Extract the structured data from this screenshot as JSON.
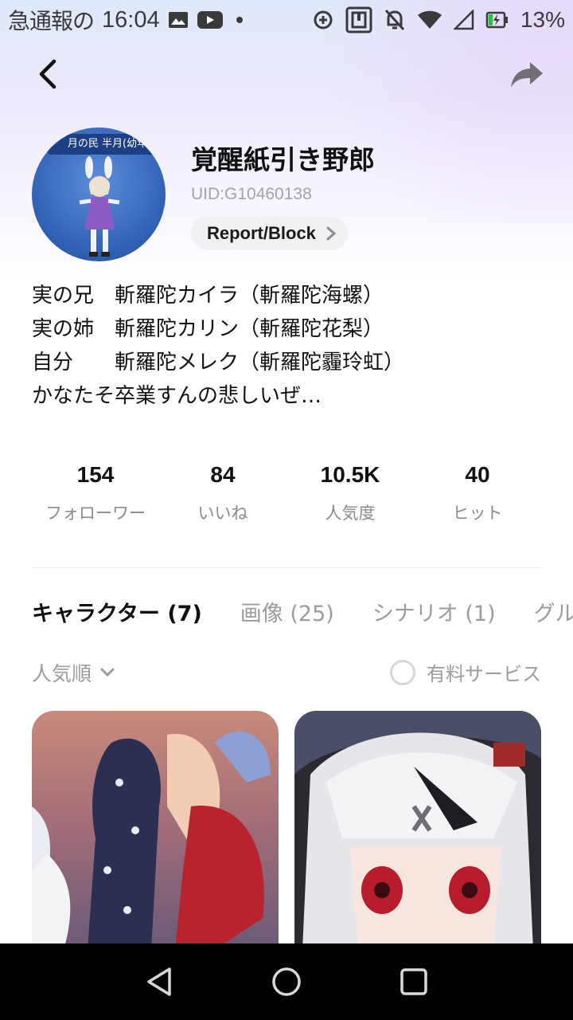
{
  "status_bar": {
    "notification_text": "急通報の",
    "time": "16:04",
    "battery": "13%"
  },
  "header": {
    "back_icon": "chevron-left-icon",
    "share_icon": "share-arrow-icon"
  },
  "profile": {
    "avatar_banner": "月の民 半月(幼年",
    "username": "覚醒紙引き野郎",
    "uid": "UID:G10460138",
    "report_label": "Report/Block"
  },
  "bio": {
    "lines": [
      "実の兄　斬羅陀カイラ（斬羅陀海螺）",
      "実の姉　斬羅陀カリン（斬羅陀花梨）",
      "自分　　斬羅陀メレク（斬羅陀霾玲虹）",
      "かなたそ卒業すんの悲しいぜ…"
    ]
  },
  "stats": [
    {
      "value": "154",
      "label": "フォローワー"
    },
    {
      "value": "84",
      "label": "いいね"
    },
    {
      "value": "10.5K",
      "label": "人気度"
    },
    {
      "value": "40",
      "label": "ヒット"
    }
  ],
  "tabs": [
    {
      "label": "キャラクター (7)",
      "active": true
    },
    {
      "label": "画像 (25)",
      "active": false
    },
    {
      "label": "シナリオ (1)",
      "active": false
    },
    {
      "label": "グル",
      "active": false
    }
  ],
  "sort": {
    "label": "人気順",
    "paid_label": "有料サービス"
  },
  "colors": {
    "accent_text": "#111111",
    "muted_text": "#9b9ba0",
    "nav_bar": "#000000"
  }
}
